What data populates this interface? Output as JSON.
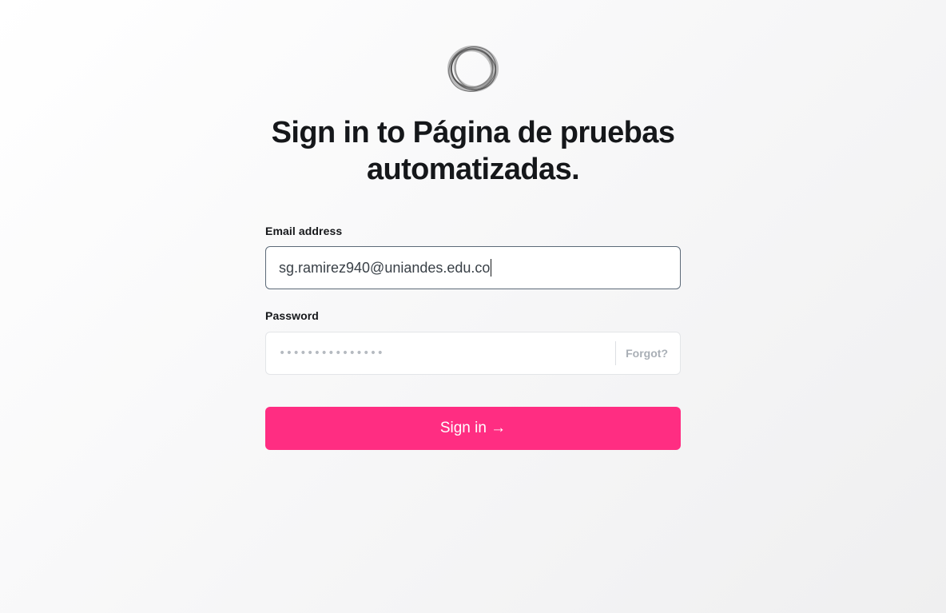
{
  "site": {
    "title": "Sign in to Página de pruebas automatizadas."
  },
  "form": {
    "email_label": "Email address",
    "email_value": "sg.ramirez940@uniandes.edu.co",
    "password_label": "Password",
    "password_value": "•••••••••••••••",
    "forgot_label": "Forgot?",
    "submit_label": "Sign in →"
  },
  "icons": {
    "logo": "ring-logo-icon"
  },
  "colors": {
    "accent": "#ff2d82",
    "text": "#15171a",
    "muted": "#a9afb6"
  }
}
